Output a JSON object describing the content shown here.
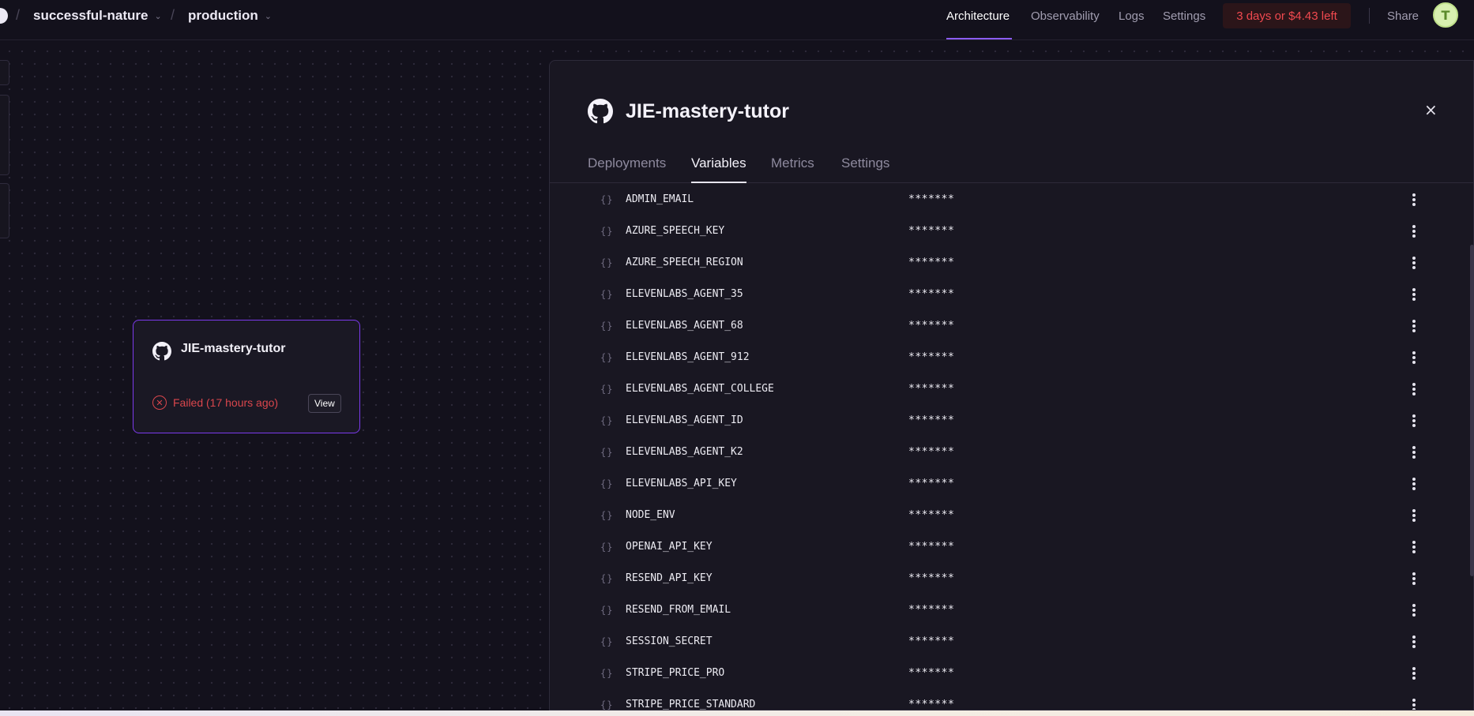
{
  "topbar": {
    "project": "successful-nature",
    "environment": "production",
    "nav": [
      "Architecture",
      "Observability",
      "Logs",
      "Settings"
    ],
    "active_nav": "Architecture",
    "trial_badge": "3 days or $4.43 left",
    "share_label": "Share",
    "avatar_initial": "T"
  },
  "canvas": {
    "service_card": {
      "name": "JIE-mastery-tutor",
      "status": "Failed (17 hours ago)",
      "view_label": "View"
    }
  },
  "panel": {
    "title": "JIE-mastery-tutor",
    "close_label": "×",
    "tabs": [
      "Deployments",
      "Variables",
      "Metrics",
      "Settings"
    ],
    "active_tab": "Variables",
    "variables": [
      {
        "name": "ADMIN_EMAIL",
        "value": "*******"
      },
      {
        "name": "AZURE_SPEECH_KEY",
        "value": "*******"
      },
      {
        "name": "AZURE_SPEECH_REGION",
        "value": "*******"
      },
      {
        "name": "ELEVENLABS_AGENT_35",
        "value": "*******"
      },
      {
        "name": "ELEVENLABS_AGENT_68",
        "value": "*******"
      },
      {
        "name": "ELEVENLABS_AGENT_912",
        "value": "*******"
      },
      {
        "name": "ELEVENLABS_AGENT_COLLEGE",
        "value": "*******"
      },
      {
        "name": "ELEVENLABS_AGENT_ID",
        "value": "*******"
      },
      {
        "name": "ELEVENLABS_AGENT_K2",
        "value": "*******"
      },
      {
        "name": "ELEVENLABS_API_KEY",
        "value": "*******"
      },
      {
        "name": "NODE_ENV",
        "value": "*******"
      },
      {
        "name": "OPENAI_API_KEY",
        "value": "*******"
      },
      {
        "name": "RESEND_API_KEY",
        "value": "*******"
      },
      {
        "name": "RESEND_FROM_EMAIL",
        "value": "*******"
      },
      {
        "name": "SESSION_SECRET",
        "value": "*******"
      },
      {
        "name": "STRIPE_PRICE_PRO",
        "value": "*******"
      },
      {
        "name": "STRIPE_PRICE_STANDARD",
        "value": "*******"
      }
    ],
    "brace_glyph": "{}"
  },
  "colors": {
    "accent": "#7c3aed",
    "error": "#d9464c",
    "background": "#13111c"
  }
}
